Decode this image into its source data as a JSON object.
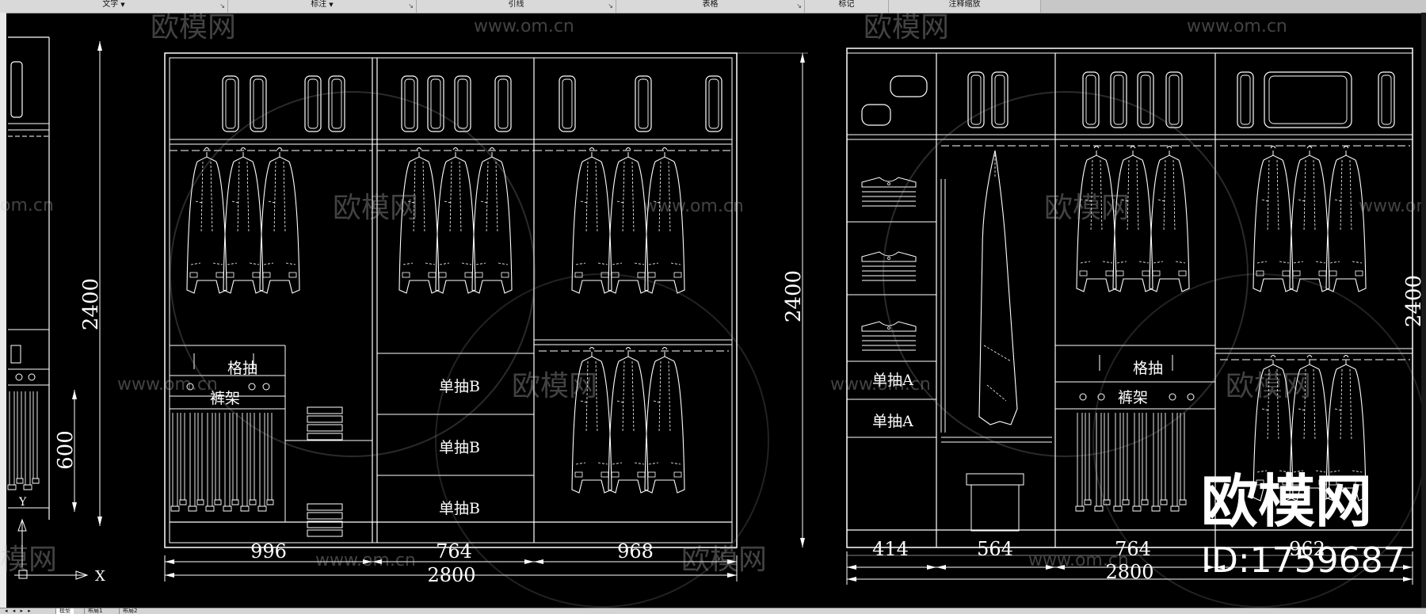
{
  "ribbon": {
    "groups": [
      {
        "label": "文字",
        "dropdown": true
      },
      {
        "label": "标注",
        "dropdown": true
      },
      {
        "label": "引线",
        "dropdown": false
      },
      {
        "label": "表格",
        "dropdown": false
      },
      {
        "label": "标记",
        "dropdown": false
      },
      {
        "label": "注释缩放",
        "dropdown": false
      }
    ]
  },
  "layout_tabs": {
    "nav": "◂ ◂ ▸ ▸",
    "tabs": [
      {
        "label": "模型",
        "active": true
      },
      {
        "label": "布局1",
        "active": false
      },
      {
        "label": "布局2",
        "active": false
      }
    ]
  },
  "watermark": {
    "brand": "欧模网",
    "url": "www.om.cn",
    "url_partial": "om.cn",
    "brand_partial": "模网",
    "id": "ID:1759687"
  },
  "drawing": {
    "left_elevation": {
      "height_dim": "2400",
      "widths": [
        "996",
        "764",
        "968"
      ],
      "total": "2800",
      "labels": {
        "grid_drawer": "格抽",
        "pants_rack": "裤架",
        "drawer_1": "单抽B",
        "drawer_2": "单抽B",
        "drawer_3": "单抽B"
      }
    },
    "partial_elevation": {
      "height_dim": "2400",
      "sub_dim": "600"
    },
    "right_elevation": {
      "height_dim": "2400",
      "partial_height_dim": "2400",
      "widths": [
        "414",
        "564",
        "764",
        "962"
      ],
      "total": "2800",
      "labels": {
        "drawer_a1": "单抽A",
        "drawer_a2": "单抽A",
        "grid_drawer": "格抽",
        "pants_rack": "裤架"
      }
    }
  },
  "colors": {
    "background": "#000000",
    "linework": "#ffffff",
    "ribbon": "#d9d9d9"
  }
}
